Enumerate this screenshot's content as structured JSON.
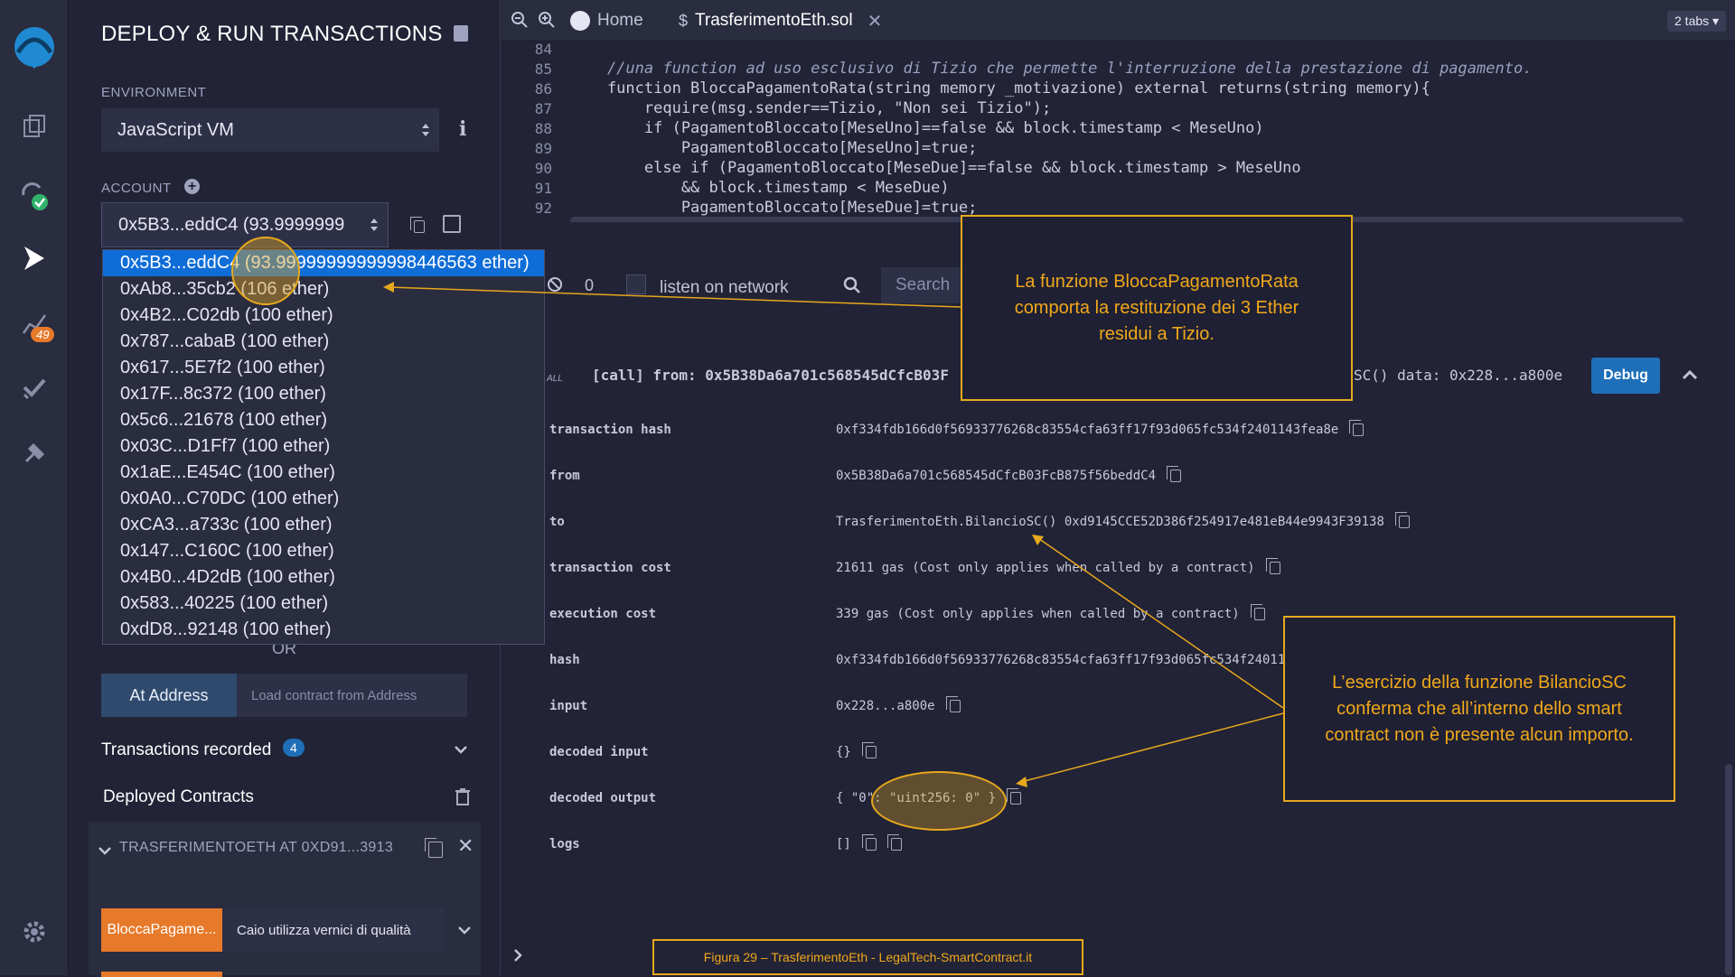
{
  "panel": {
    "title": "DEPLOY & RUN TRANSACTIONS",
    "environment_label": "ENVIRONMENT",
    "environment_value": "JavaScript VM",
    "account_label": "ACCOUNT",
    "account_value": "0x5B3...eddC4 (93.9999999",
    "accounts": [
      "0x5B3...eddC4 (93.99999999999998446563 ether)",
      "0xAb8...35cb2 (106 ether)",
      "0x4B2...C02db (100 ether)",
      "0x787...cabaB (100 ether)",
      "0x617...5E7f2 (100 ether)",
      "0x17F...8c372 (100 ether)",
      "0x5c6...21678 (100 ether)",
      "0x03C...D1Ff7 (100 ether)",
      "0x1aE...E454C (100 ether)",
      "0x0A0...C70DC (100 ether)",
      "0xCA3...a733c (100 ether)",
      "0x147...C160C (100 ether)",
      "0x4B0...4D2dB (100 ether)",
      "0x583...40225 (100 ether)",
      "0xdD8...92148 (100 ether)"
    ],
    "or_text": "OR",
    "at_address_label": "At Address",
    "at_address_placeholder": "Load contract from Address",
    "transactions_recorded_label": "Transactions recorded",
    "transactions_recorded_count": "4",
    "deployed_contracts_label": "Deployed Contracts",
    "contract_instance": "TRASFERIMENTOETH AT 0XD91...3913",
    "fn_button": "BloccaPagame...",
    "fn_input_value": "Caio utilizza vernici di qualità"
  },
  "rail": {
    "badge": "49"
  },
  "tabs": {
    "home": "Home",
    "file": "TrasferimentoEth.sol",
    "count": "2 tabs"
  },
  "editor": {
    "lines": [
      {
        "n": "84",
        "text": ""
      },
      {
        "n": "85",
        "text": "    //una function ad uso esclusivo di Tizio che permette l'interruzione della prestazione di pagamento."
      },
      {
        "n": "86",
        "text": "    function BloccaPagamentoRata(string memory _motivazione) external returns(string memory){"
      },
      {
        "n": "87",
        "text": "        require(msg.sender==Tizio, \"Non sei Tizio\");"
      },
      {
        "n": "88",
        "text": "        if (PagamentoBloccato[MeseUno]==false && block.timestamp < MeseUno)"
      },
      {
        "n": "89",
        "text": "            PagamentoBloccato[MeseUno]=true;"
      },
      {
        "n": "90",
        "text": "        else if (PagamentoBloccato[MeseDue]==false && block.timestamp > MeseUno"
      },
      {
        "n": "91",
        "text": "            && block.timestamp < MeseDue)"
      },
      {
        "n": "92",
        "text": "            PagamentoBloccato[MeseDue]=true;"
      }
    ]
  },
  "terminal": {
    "count": "0",
    "listen_label": "listen on network",
    "search_placeholder": "Search",
    "call_prefix": "ALL",
    "call_line": "[call]  from: 0x5B38Da6a701c568545dCfcB03F",
    "call_line_end": "SC() data: 0x228...a800e",
    "debug_label": "Debug",
    "rows": [
      {
        "label": "transaction hash",
        "value": "0xf334fdb166d0f56933776268c83554cfa63ff17f93d065fc534f2401143fea8e"
      },
      {
        "label": "from",
        "value": "0x5B38Da6a701c568545dCfcB03FcB875f56beddC4"
      },
      {
        "label": "to",
        "value": "TrasferimentoEth.BilancioSC() 0xd9145CCE52D386f254917e481eB44e9943F39138"
      },
      {
        "label": "transaction cost",
        "value": "21611 gas (Cost only applies when called by a contract)"
      },
      {
        "label": "execution cost",
        "value": "339 gas (Cost only applies when called by a contract)"
      },
      {
        "label": "hash",
        "value": "0xf334fdb166d0f56933776268c83554cfa63ff17f93d065fc534f240114"
      },
      {
        "label": "input",
        "value": "0x228...a800e"
      },
      {
        "label": "decoded input",
        "value": "{}"
      },
      {
        "label": "decoded output",
        "value": "{ \"0\": \"uint256: 0\" }"
      },
      {
        "label": "logs",
        "value": "[]"
      }
    ]
  },
  "annotations": {
    "note1": "La funzione BloccaPagamentoRata comporta la restituzione dei 3 Ether residui a Tizio.",
    "note2": "L’esercizio della funzione BilancioSC conferma che all’interno dello smart contract non è presente alcun importo.",
    "caption": "Figura 29 – TrasferimentoEth - LegalTech-SmartContract.it"
  },
  "colors": {
    "accent": "#e6a81c",
    "selected": "#0f6dd8",
    "orange": "#e7792a",
    "debug": "#1e6fb8"
  }
}
